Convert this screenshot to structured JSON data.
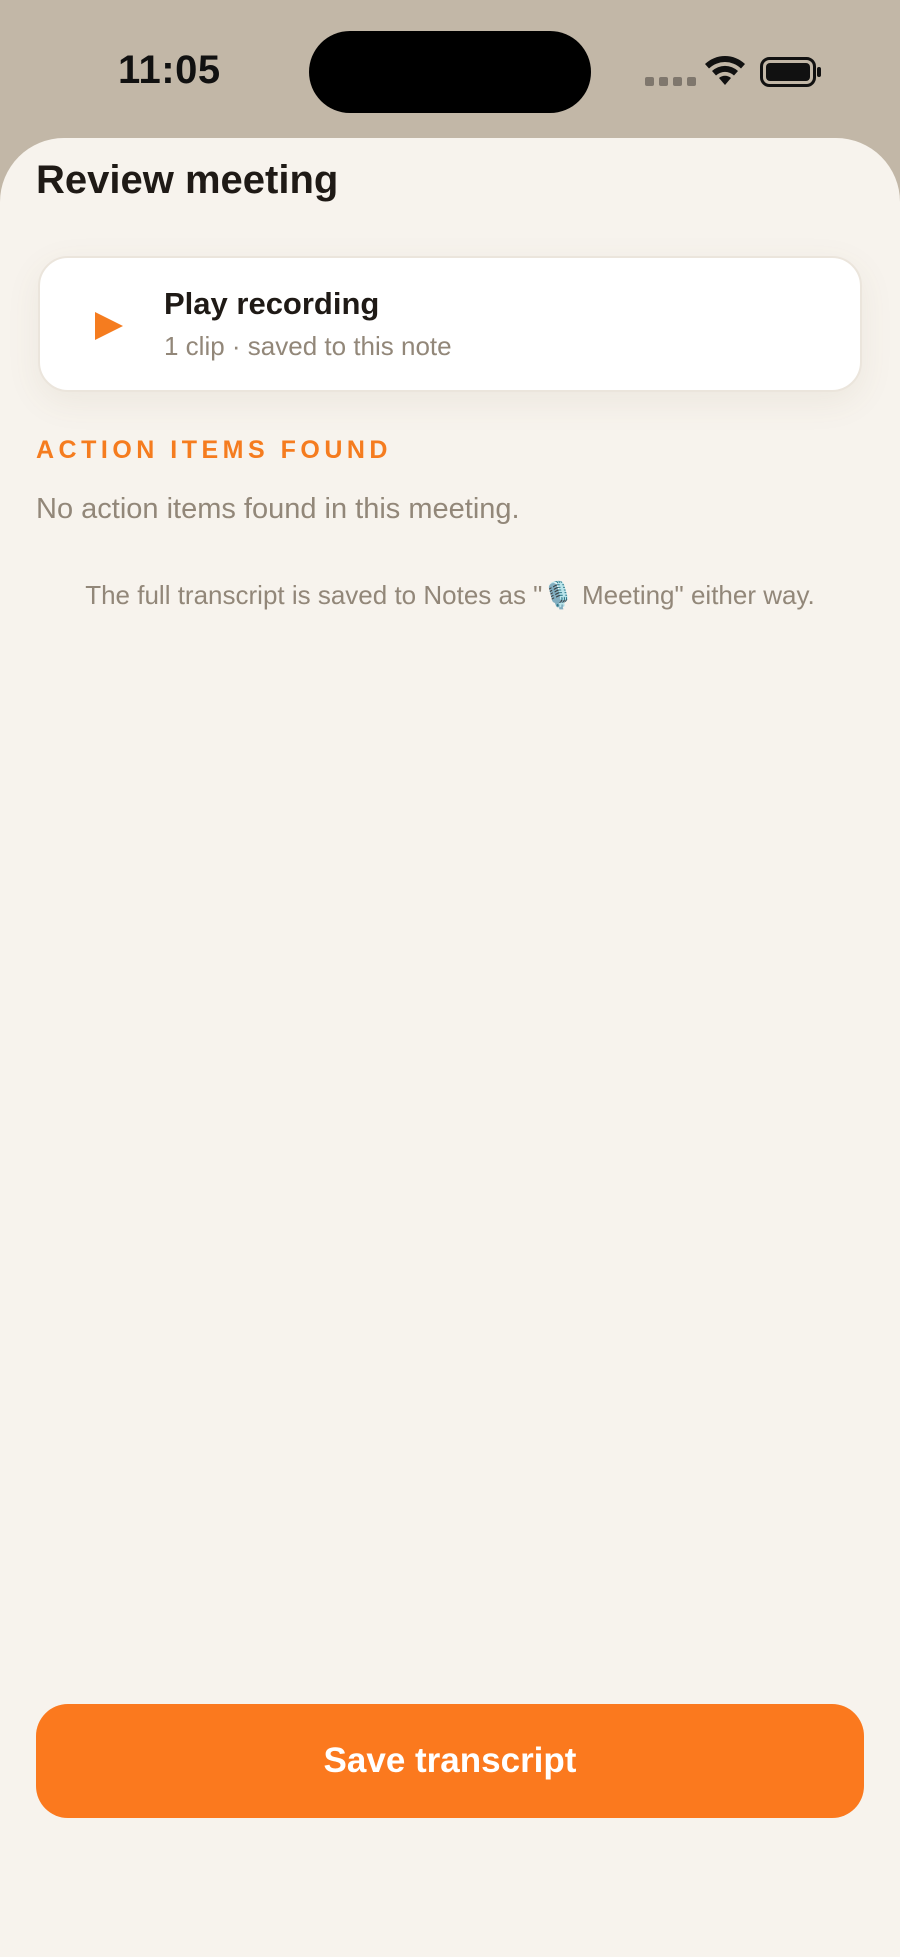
{
  "status_bar": {
    "time": "11:05"
  },
  "sheet": {
    "title": "Review meeting"
  },
  "recording": {
    "title": "Play recording",
    "subtitle": "1 clip · saved to this note",
    "icon": "play-icon"
  },
  "action_items": {
    "header": "ACTION ITEMS FOUND",
    "empty_message": "No action items found in this meeting."
  },
  "footnote": "The full transcript is saved to Notes as \"🎙️ Meeting\" either way.",
  "footer": {
    "save_label": "Save transcript"
  },
  "colors": {
    "accent": "#fb791e",
    "background": "#f7f3ed",
    "status_bar": "#c2b7a7",
    "muted_text": "#928779",
    "title_text": "#1f1a16"
  }
}
